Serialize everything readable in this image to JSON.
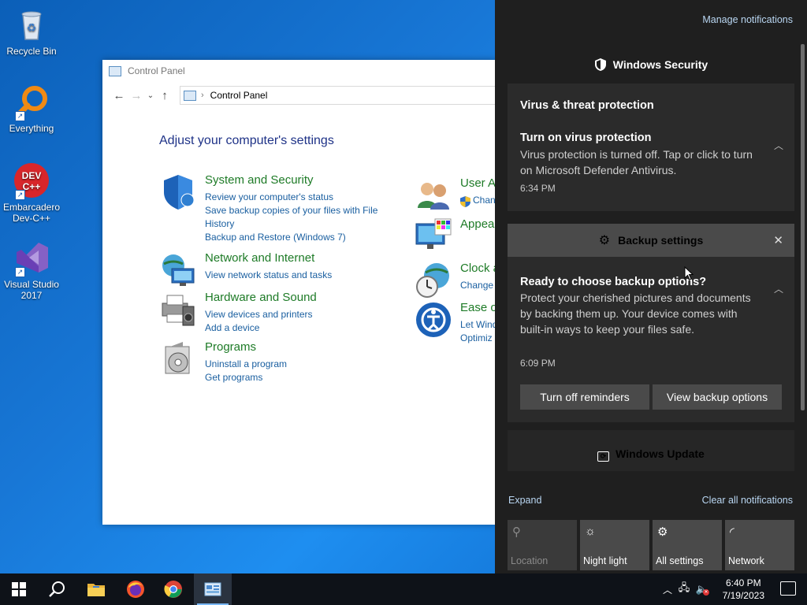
{
  "desktop": {
    "icons": [
      {
        "label": "Recycle Bin"
      },
      {
        "label": "Everything"
      },
      {
        "label": "Embarcadero Dev-C++"
      },
      {
        "label": "Visual Studio 2017"
      }
    ]
  },
  "control_panel": {
    "title": "Control Panel",
    "address": "Control Panel",
    "heading": "Adjust your computer's settings",
    "categories": [
      {
        "title": "System and Security",
        "links": [
          "Review your computer's status",
          "Save backup copies of your files with File History",
          "Backup and Restore (Windows 7)"
        ]
      },
      {
        "title": "Network and Internet",
        "links": [
          "View network status and tasks"
        ]
      },
      {
        "title": "Hardware and Sound",
        "links": [
          "View devices and printers",
          "Add a device"
        ]
      },
      {
        "title": "Programs",
        "links": [
          "Uninstall a program",
          "Get programs"
        ]
      },
      {
        "title": "User A",
        "links": [
          "Chan"
        ]
      },
      {
        "title": "Appea",
        "links": []
      },
      {
        "title": "Clock a",
        "links": [
          "Change"
        ]
      },
      {
        "title": "Ease o",
        "links": [
          "Let Wind",
          "Optimiz"
        ]
      }
    ]
  },
  "action_center": {
    "manage": "Manage notifications",
    "security_group": "Windows Security",
    "security_card": {
      "header": "Virus & threat protection",
      "title": "Turn on virus protection",
      "body": "Virus protection is turned off. Tap or click to turn on Microsoft Defender Antivirus.",
      "time": "6:34 PM"
    },
    "backup_group": "Backup settings",
    "backup_card": {
      "title": "Ready to choose backup options?",
      "body": "Protect your cherished pictures and documents by backing them up. Your device comes with built-in ways to keep your files safe.",
      "time": "6:09 PM",
      "btn1": "Turn off reminders",
      "btn2": "View backup options"
    },
    "update_group": "Windows Update",
    "expand": "Expand",
    "clear": "Clear all notifications",
    "quick_actions": [
      {
        "label": "Location",
        "icon": "location-icon",
        "on": false
      },
      {
        "label": "Night light",
        "icon": "night-light-icon",
        "on": true
      },
      {
        "label": "All settings",
        "icon": "gear-icon",
        "on": true
      },
      {
        "label": "Network",
        "icon": "network-icon",
        "on": true
      }
    ],
    "colors": {
      "panel": "#1f1f1f",
      "card": "#2b2b2b",
      "button": "#4a4a4a",
      "link": "#b9d6f2"
    }
  },
  "taskbar": {
    "time": "6:40 PM",
    "date": "7/19/2023"
  }
}
